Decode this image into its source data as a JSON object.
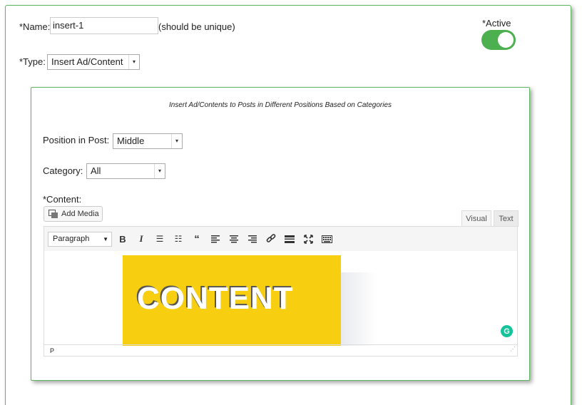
{
  "form": {
    "name_label": "*Name:",
    "name_value": "insert-1",
    "name_hint": "(should be unique)",
    "type_label": "*Type:",
    "type_value": "Insert Ad/Content",
    "active_label": "*Active",
    "active_on": true
  },
  "inner": {
    "caption": "Insert Ad/Contents to Posts in Different Positions Based on Categories",
    "position_label": "Position in Post:",
    "position_value": "Middle",
    "category_label": "Category:",
    "category_value": "All",
    "content_label": "*Content:"
  },
  "editor": {
    "add_media_label": "Add Media",
    "tab_visual": "Visual",
    "tab_text": "Text",
    "format_value": "Paragraph",
    "toolbar_icons": [
      "bold-icon",
      "italic-icon",
      "bullet-list-icon",
      "numbered-list-icon",
      "blockquote-icon",
      "align-left-icon",
      "align-center-icon",
      "align-right-icon",
      "link-icon",
      "read-more-icon",
      "fullscreen-icon",
      "toolbar-toggle-icon"
    ],
    "image_text": "CONTENT",
    "status_path": "P",
    "grammarly_letter": "G"
  }
}
